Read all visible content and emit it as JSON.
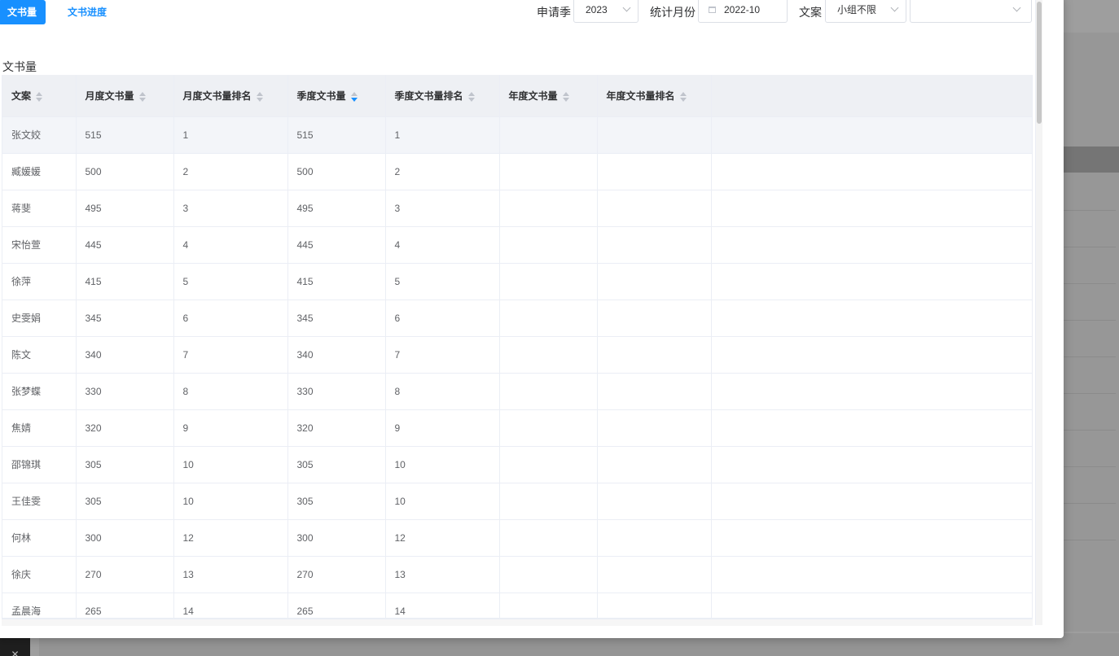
{
  "tabs": [
    {
      "label": "文书量",
      "active": true
    },
    {
      "label": "文书进度",
      "active": false
    }
  ],
  "filters": {
    "season_label": "申请季",
    "season_value": "2023",
    "month_label": "统计月份",
    "month_value": "2022-10",
    "writer_label": "文案",
    "writer_group_value": "小组不限",
    "writer_value": ""
  },
  "section_title": "文书量",
  "table": {
    "columns": [
      "文案",
      "月度文书量",
      "月度文书量排名",
      "季度文书量",
      "季度文书量排名",
      "年度文书量",
      "年度文书量排名"
    ],
    "sorted_column": "季度文书量",
    "sort_direction": "descending",
    "rows": [
      [
        "张文姣",
        "515",
        "1",
        "515",
        "1",
        "",
        ""
      ],
      [
        "臧媛媛",
        "500",
        "2",
        "500",
        "2",
        "",
        ""
      ],
      [
        "蒋斐",
        "495",
        "3",
        "495",
        "3",
        "",
        ""
      ],
      [
        "宋怡萱",
        "445",
        "4",
        "445",
        "4",
        "",
        ""
      ],
      [
        "徐萍",
        "415",
        "5",
        "415",
        "5",
        "",
        ""
      ],
      [
        "史雯娟",
        "345",
        "6",
        "345",
        "6",
        "",
        ""
      ],
      [
        "陈文",
        "340",
        "7",
        "340",
        "7",
        "",
        ""
      ],
      [
        "张梦蝶",
        "330",
        "8",
        "330",
        "8",
        "",
        ""
      ],
      [
        "焦婧",
        "320",
        "9",
        "320",
        "9",
        "",
        ""
      ],
      [
        "邵锦琪",
        "305",
        "10",
        "305",
        "10",
        "",
        ""
      ],
      [
        "王佳雯",
        "305",
        "10",
        "305",
        "10",
        "",
        ""
      ],
      [
        "何林",
        "300",
        "12",
        "300",
        "12",
        "",
        ""
      ],
      [
        "徐庆",
        "270",
        "13",
        "270",
        "13",
        "",
        ""
      ],
      [
        "孟晨海",
        "265",
        "14",
        "265",
        "14",
        "",
        ""
      ]
    ]
  },
  "colors": {
    "accent": "#1890ff",
    "header_bg": "#eef0f4",
    "row_highlight": "#f3f5f9"
  },
  "icons": {
    "select": "chevron-down-icon",
    "date": "calendar-icon",
    "sort": "sort-caret-icon",
    "corner": "close-icon"
  }
}
